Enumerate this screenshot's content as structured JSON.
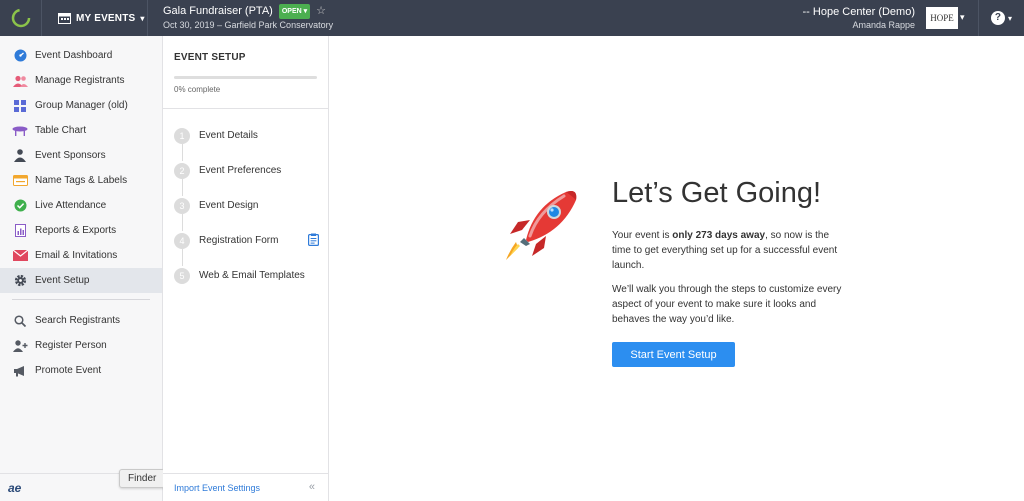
{
  "header": {
    "my_events_label": "MY EVENTS",
    "event_title": "Gala Fundraiser (PTA)",
    "status_badge": "OPEN",
    "event_subtitle": "Oct 30, 2019 – Garfield Park Conservatory",
    "org_name": "-- Hope Center (Demo)",
    "user_name": "Amanda Rappe",
    "org_logo_text": "HOPE"
  },
  "sidebar": {
    "items": [
      {
        "label": "Event Dashboard",
        "icon": "dashboard-icon",
        "color": "#2f7bd9"
      },
      {
        "label": "Manage Registrants",
        "icon": "people-icon",
        "color": "#e55b78"
      },
      {
        "label": "Group Manager (old)",
        "icon": "grid-icon",
        "color": "#5b6bd6"
      },
      {
        "label": "Table Chart",
        "icon": "table-icon",
        "color": "#8a5cc7"
      },
      {
        "label": "Event Sponsors",
        "icon": "sponsor-icon",
        "color": "#444a55"
      },
      {
        "label": "Name Tags & Labels",
        "icon": "nametag-icon",
        "color": "#f2a72e"
      },
      {
        "label": "Live Attendance",
        "icon": "check-circle-icon",
        "color": "#3fb04d"
      },
      {
        "label": "Reports & Exports",
        "icon": "report-icon",
        "color": "#8a5cc7"
      },
      {
        "label": "Email & Invitations",
        "icon": "envelope-icon",
        "color": "#e0475e"
      },
      {
        "label": "Event Setup",
        "icon": "gear-icon",
        "color": "#444a55"
      }
    ],
    "secondary_items": [
      {
        "label": "Search Registrants",
        "icon": "search-icon"
      },
      {
        "label": "Register Person",
        "icon": "add-person-icon"
      },
      {
        "label": "Promote Event",
        "icon": "megaphone-icon"
      }
    ],
    "active_item": "Event Setup",
    "bottom_logo": "ae",
    "tooltip": "Finder"
  },
  "setup": {
    "title": "EVENT SETUP",
    "progress_percent": 0,
    "progress_label": "0% complete",
    "steps": [
      {
        "num": "1",
        "label": "Event Details"
      },
      {
        "num": "2",
        "label": "Event Preferences"
      },
      {
        "num": "3",
        "label": "Event Design"
      },
      {
        "num": "4",
        "label": "Registration Form"
      },
      {
        "num": "5",
        "label": "Web & Email Templates"
      }
    ],
    "import_link": "Import Event Settings"
  },
  "main": {
    "headline": "Let’s Get Going!",
    "para1_prefix": "Your event is ",
    "para1_bold": "only 273 days away",
    "para1_suffix": ", so now is the time to get everything set up for a successful event launch.",
    "para2": "We’ll walk you through the steps to customize every aspect of your event to make sure it looks and behaves the way you’d like.",
    "start_button": "Start Event Setup"
  },
  "colors": {
    "topbar_bg": "#3a4150",
    "accent_blue": "#2c8ef0",
    "open_green": "#4caf50"
  }
}
